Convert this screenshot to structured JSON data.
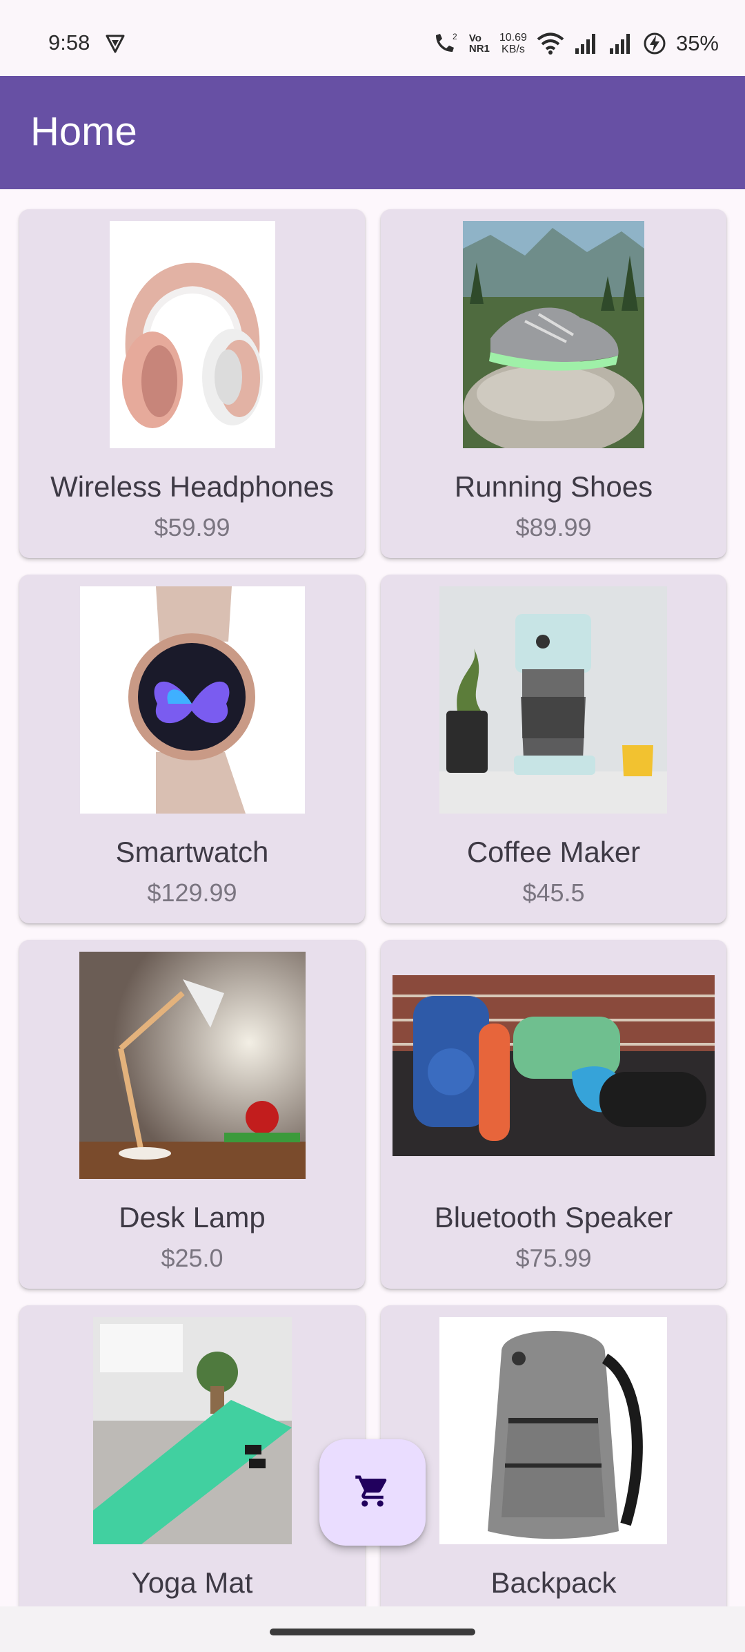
{
  "status_bar": {
    "time": "9:58",
    "net_speed_value": "10.69",
    "net_speed_unit": "KB/s",
    "volte_top": "Vo",
    "volte_bottom": "NR1",
    "battery_percent": "35%"
  },
  "app_bar": {
    "title": "Home"
  },
  "products": [
    {
      "name": "Wireless Headphones",
      "price": "$59.99",
      "image_icon": "headphones-image"
    },
    {
      "name": "Running Shoes",
      "price": "$89.99",
      "image_icon": "running-shoe-image"
    },
    {
      "name": "Smartwatch",
      "price": "$129.99",
      "image_icon": "smartwatch-image"
    },
    {
      "name": "Coffee Maker",
      "price": "$45.5",
      "image_icon": "coffee-maker-image"
    },
    {
      "name": "Desk Lamp",
      "price": "$25.0",
      "image_icon": "desk-lamp-image"
    },
    {
      "name": "Bluetooth Speaker",
      "price": "$75.99",
      "image_icon": "bluetooth-speaker-image"
    },
    {
      "name": "Yoga Mat",
      "price": "",
      "image_icon": "yoga-mat-image"
    },
    {
      "name": "Backpack",
      "price": "",
      "image_icon": "backpack-image"
    }
  ],
  "fab": {
    "icon": "shopping-cart-icon"
  },
  "colors": {
    "app_bar": "#6750a4",
    "card_background": "#e8dfec",
    "fab_background": "#eaddff",
    "cart_icon": "#21005d"
  }
}
